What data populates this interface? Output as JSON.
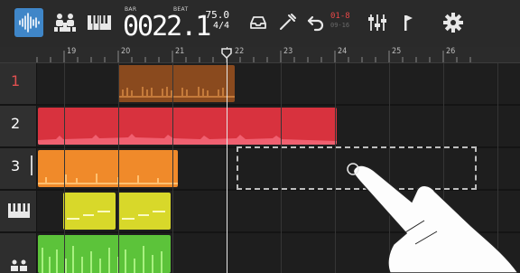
{
  "toolbar": {
    "tools": [
      {
        "id": "waveform",
        "icon": "waveform-icon",
        "active": true
      },
      {
        "id": "mixer",
        "icon": "people-icon",
        "active": false
      },
      {
        "id": "keyboard",
        "icon": "keyboard-icon",
        "active": false
      }
    ],
    "counter": {
      "bars_label": "BAR",
      "beat_label": "BEAT",
      "value": "0022.1"
    },
    "tempo": {
      "bpm": "75.0",
      "time_signature": "4/4"
    },
    "routing": {
      "line1": "01-8",
      "line2": "09-16"
    },
    "right_icons": [
      "tray-icon",
      "wand-icon",
      "undo-icon",
      "routing-icon",
      "faders-icon",
      "flag-icon",
      "gear-icon"
    ]
  },
  "ruler": {
    "bars": [
      "19",
      "20",
      "21",
      "22",
      "23",
      "24",
      "25",
      "26"
    ]
  },
  "tracks": [
    {
      "number": "1",
      "number_color": "#e05050",
      "icon": null
    },
    {
      "number": "2",
      "number_color": "#ffffff",
      "icon": null
    },
    {
      "number": "3",
      "number_color": "#ffffff",
      "icon": null
    },
    {
      "number": "",
      "number_color": "#ffffff",
      "icon": "keyboard-icon"
    },
    {
      "number": "",
      "number_color": "#ffffff",
      "icon": "drums-icon"
    }
  ],
  "colors": {
    "accent": "#3f86c8",
    "track1_region": "#8a4a1e",
    "track2_region": "#d8323e",
    "track3_region": "#f08a2a",
    "track4_region": "#d8d82a",
    "track5_region": "#5cc33a"
  }
}
